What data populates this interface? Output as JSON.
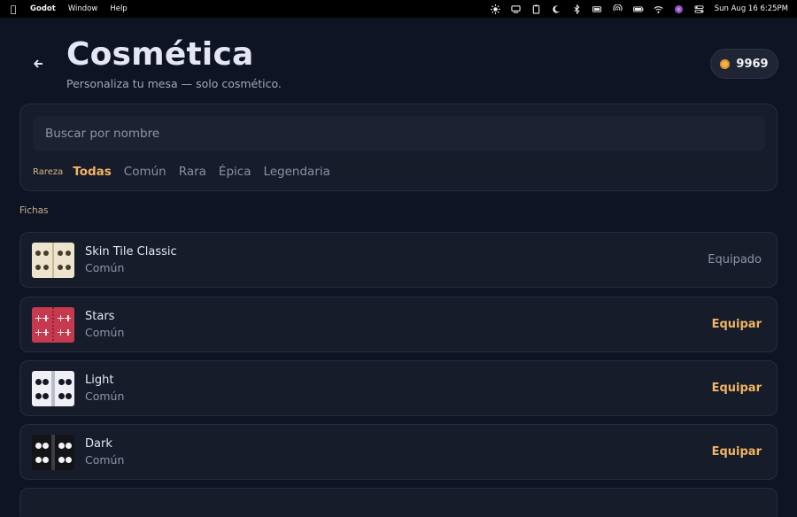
{
  "menubar": {
    "app_name": "Godot",
    "menus": [
      "Window",
      "Help"
    ],
    "clock": "Sun Aug 16  6:25PM",
    "status_icons": [
      "brightness-icon",
      "display-icon",
      "clipboard-icon",
      "moon-icon",
      "bluetooth-icon",
      "battery-icon",
      "airplay-icon",
      "battery-full-icon",
      "wifi-icon",
      "siri-icon",
      "control-center-icon"
    ]
  },
  "header": {
    "title": "Cosmética",
    "subtitle": "Personaliza tu mesa — solo cosmético.",
    "coins": "9969",
    "coin_color": "#f2b24a"
  },
  "search": {
    "placeholder": "Buscar por nombre"
  },
  "filters": {
    "label": "Rareza",
    "options": [
      "Todas",
      "Común",
      "Rara",
      "Épica",
      "Legendaria"
    ],
    "selected": "Todas"
  },
  "section_title": "Fichas",
  "items": [
    {
      "name": "Skin Tile Classic",
      "rarity": "Común",
      "action": "Equipado",
      "style": "classic"
    },
    {
      "name": "Stars",
      "rarity": "Común",
      "action": "Equipar",
      "style": "stars"
    },
    {
      "name": "Light",
      "rarity": "Común",
      "action": "Equipar",
      "style": "light"
    },
    {
      "name": "Dark",
      "rarity": "Común",
      "action": "Equipar",
      "style": "dark"
    }
  ],
  "colors": {
    "background": "#0e1424",
    "panel": "#171c2b",
    "accent": "#f0b463",
    "muted": "#8f95a8"
  }
}
